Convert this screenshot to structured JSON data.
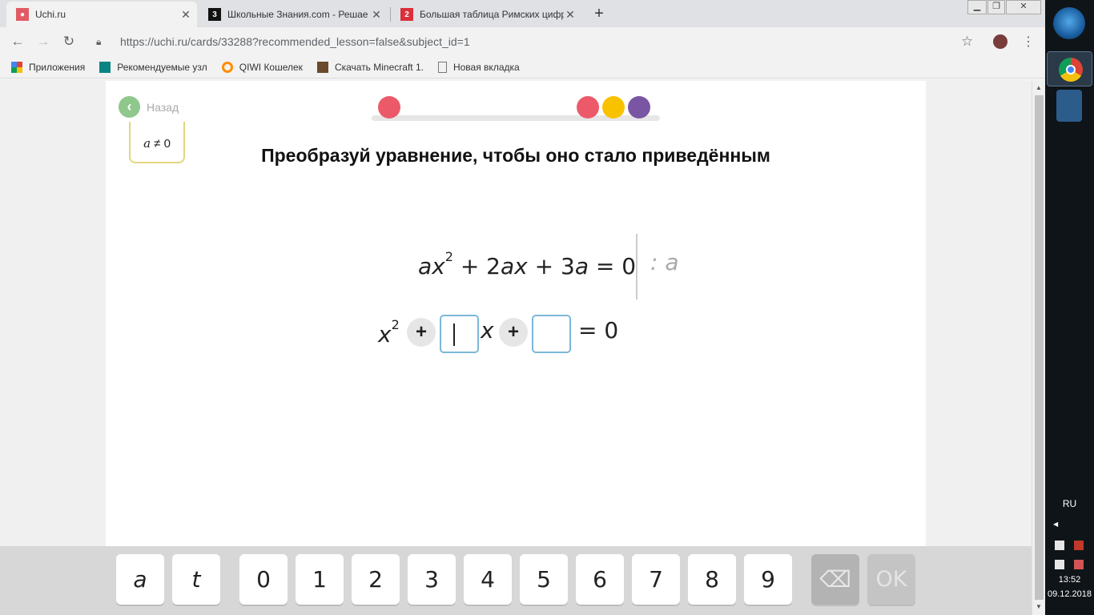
{
  "browser": {
    "tabs": [
      {
        "title": "Uchi.ru",
        "favicon": "uchi-logo",
        "active": true
      },
      {
        "title": "Школьные Знания.com - Решае",
        "favicon": "znaniya-logo",
        "active": false
      },
      {
        "title": "Большая таблица Римских цифр",
        "favicon": "number-2-logo",
        "active": false
      }
    ],
    "new_tab": "+",
    "url": "https://uchi.ru/cards/33288?recommended_lesson=false&subject_id=1",
    "bookmarks": [
      {
        "label": "Приложения",
        "icon": "apps-grid-icon"
      },
      {
        "label": "Рекомендуемые узл",
        "icon": "bing-icon"
      },
      {
        "label": "QIWI Кошелек",
        "icon": "qiwi-icon"
      },
      {
        "label": "Скачать Minecraft 1.",
        "icon": "minecraft-icon"
      },
      {
        "label": "Новая вкладка",
        "icon": "page-icon"
      }
    ]
  },
  "lesson": {
    "back_label": "Назад",
    "hint": {
      "var": "a",
      "rest": " ≠ 0"
    },
    "progress_colors": [
      "#ec5a6a",
      "#ec5a6a",
      "#f9c200",
      "#7a55a3"
    ],
    "heading": "Преобразуй уравнение, чтобы оно стало приведённым",
    "eq1": {
      "t1": "ax",
      "exp": "2",
      "t2": " + 2",
      "t3": "ax",
      "t4": " + 3",
      "t5": "a",
      "t6": " = 0"
    },
    "divide_by": ": a",
    "eq2": {
      "x": "x",
      "exp": "2",
      "plus1": "+",
      "xvar": "x",
      "plus2": "+",
      "rhs": "= 0"
    }
  },
  "keypad": {
    "keys": [
      "a",
      "t",
      "0",
      "1",
      "2",
      "3",
      "4",
      "5",
      "6",
      "7",
      "8",
      "9"
    ],
    "backspace": "backspace-icon",
    "ok": "OK"
  },
  "taskbar": {
    "lang": "RU",
    "time": "13:52",
    "date": "09.12.2018"
  }
}
